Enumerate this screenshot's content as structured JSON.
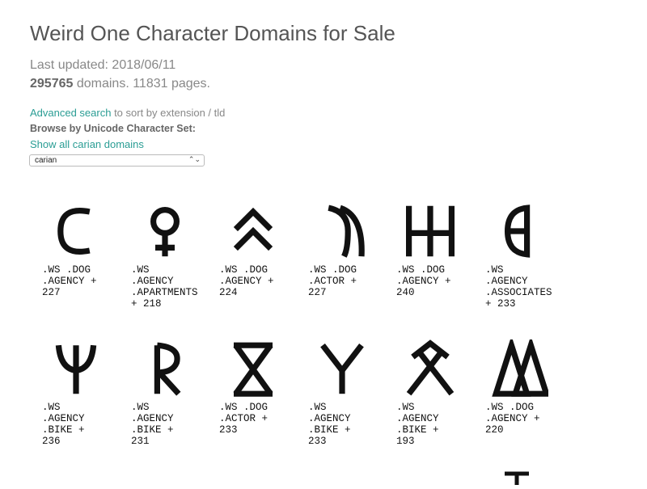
{
  "page": {
    "title": "Weird One Character Domains for Sale",
    "last_updated": "Last updated: 2018/06/11",
    "count_number": "295765",
    "count_rest": " domains. 11831 pages."
  },
  "search": {
    "advanced_link": "Advanced search",
    "advanced_rest": " to sort by extension / tld",
    "browse_label": "Browse by Unicode Character Set:",
    "show_all_link": "Show all carian domains",
    "selected_set": "carian"
  },
  "characters": [
    {
      "glyph": "c-shape",
      "lines": [
        ".WS .DOG",
        ".AGENCY +",
        "227"
      ]
    },
    {
      "glyph": "ankh-shape",
      "lines": [
        ".WS",
        ".AGENCY",
        ".APARTMENTS",
        "+ 218"
      ]
    },
    {
      "glyph": "double-chevron-up",
      "lines": [
        ".WS .DOG",
        ".AGENCY +",
        "224"
      ]
    },
    {
      "glyph": "crescent-shape",
      "lines": [
        ".WS .DOG",
        ".ACTOR +",
        "227"
      ]
    },
    {
      "glyph": "h-double-bar",
      "lines": [
        ".WS .DOG",
        ".AGENCY +",
        "240"
      ]
    },
    {
      "glyph": "theta-half",
      "lines": [
        ".WS",
        ".AGENCY",
        ".ASSOCIATES",
        "+ 233"
      ]
    },
    {
      "glyph": "psi-shape",
      "lines": [
        ".WS",
        ".AGENCY",
        ".BIKE +",
        "236"
      ]
    },
    {
      "glyph": "r-shape",
      "lines": [
        ".WS",
        ".AGENCY",
        ".BIKE +",
        "231"
      ]
    },
    {
      "glyph": "x-bar-shape",
      "lines": [
        ".WS .DOG",
        ".ACTOR +",
        "233"
      ]
    },
    {
      "glyph": "y-shape",
      "lines": [
        ".WS",
        ".AGENCY",
        ".BIKE +",
        "233"
      ]
    },
    {
      "glyph": "x-caret-shape",
      "lines": [
        ".WS",
        ".AGENCY",
        ".BIKE +",
        "193"
      ]
    },
    {
      "glyph": "double-delta",
      "lines": [
        ".WS .DOG",
        ".AGENCY +",
        "220"
      ]
    }
  ]
}
